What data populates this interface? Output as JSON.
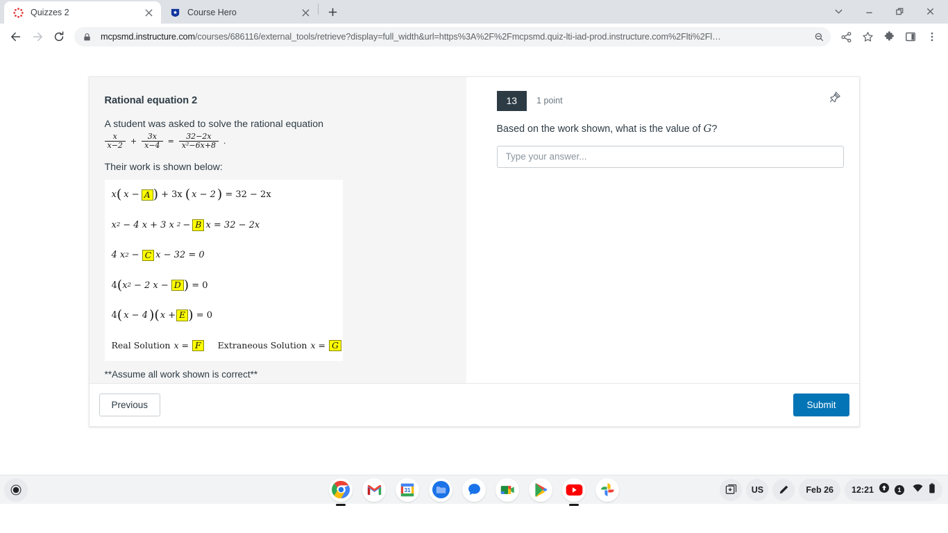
{
  "browser": {
    "tabs": [
      {
        "title": "Quizzes 2",
        "favicon": "canvas-spinner-icon",
        "active": true
      },
      {
        "title": "Course Hero",
        "favicon": "course-hero-shield-icon",
        "active": false
      }
    ],
    "new_tab_label": "+",
    "nav": {
      "back": "back-arrow-icon",
      "forward": "forward-arrow-icon",
      "reload": "reload-icon"
    },
    "omnibox": {
      "lock": "site-lock-icon",
      "url_domain": "mcpsmd.instructure.com",
      "url_path": "/courses/686116/external_tools/retrieve?display=full_width&url=https%3A%2F%2Fmcpsmd.quiz-lti-iad-prod.instructure.com%2Flti%2Fl…",
      "zoom_icon": "zoom-out-icon"
    },
    "actions": {
      "share": "share-icon",
      "bookmark": "bookmark-star-icon",
      "extensions": "extensions-puzzle-icon",
      "sidepanel": "side-panel-icon",
      "menu": "three-dot-menu-icon"
    },
    "window": {
      "tablist": "tab-search-chevron-icon",
      "minimize": "minimize-icon",
      "maximize": "maximize-icon",
      "close": "close-icon"
    }
  },
  "quiz": {
    "stimulus": {
      "title": "Rational equation 2",
      "intro": "A student was asked to solve the rational equation",
      "equation": {
        "term1": {
          "num": "x",
          "den": "x−2"
        },
        "op1": "+",
        "term2": {
          "num": "3x",
          "den": "x−4"
        },
        "op2": "=",
        "term3": {
          "num": "32−2x",
          "den": "x²−6x+8"
        },
        "period": "."
      },
      "work_label": "Their work is shown below:",
      "work_lines": [
        "x(x − [A]) + 3x(x − 2) = 32 − 2x",
        "x² − 4x + 3x² −[B]x = 32 − 2x",
        "4x² −[C]x − 32 = 0",
        "4(x² − 2x −[D]) = 0",
        "4(x − 4)(x +[E]) = 0",
        "Real Solution x = [F]    Extraneous  Solution x = [G]"
      ],
      "blanks": [
        "A",
        "B",
        "C",
        "D",
        "E",
        "F",
        "G"
      ],
      "line1": {
        "a": "x",
        "b": "x −",
        "blank": "A",
        "c": "+ 3x",
        "d": "x − 2",
        "e": "= 32 − 2x"
      },
      "line2": {
        "a": "x",
        "sup": "2",
        "b": "− 4 x  +  3 x",
        "sup2": "2",
        "c": "−",
        "blank": "B",
        "d": "x = 32 − 2x"
      },
      "line3": {
        "a": "4 x",
        "sup": "2",
        "b": "−",
        "blank": "C",
        "c": "x − 32 = 0"
      },
      "line4": {
        "a": "4",
        "b": "x",
        "sup": "2",
        "c": "− 2 x  −",
        "blank": "D",
        "d": "= 0"
      },
      "line5": {
        "a": "4",
        "b": "x −  4",
        "c": "x +",
        "blank": "E",
        "d": "= 0"
      },
      "line6": {
        "a": "Real Solution",
        "b": "x =",
        "blank1": "F",
        "c": "Extraneous   Solution",
        "d": "x =",
        "blank2": "G"
      },
      "assume_note": "**Assume all work shown is correct**"
    },
    "question": {
      "number": "13",
      "points": "1 point",
      "pin_icon": "pushpin-icon",
      "prompt_before": "Based on the work shown, what is the value of ",
      "prompt_var": "G",
      "prompt_after": "?",
      "answer_value": "",
      "answer_placeholder": "Type your answer..."
    },
    "footer": {
      "previous_label": "Previous",
      "submit_label": "Submit"
    },
    "colors": {
      "submit_blue": "#0374b5",
      "question_badge": "#2d3b45",
      "highlight_yellow": "#ffff00"
    }
  },
  "shelf": {
    "launcher": "launcher-icon",
    "apps": [
      {
        "name": "chrome-icon",
        "label": "Chrome",
        "running": true
      },
      {
        "name": "gmail-icon",
        "label": "Gmail",
        "running": false
      },
      {
        "name": "calendar-icon",
        "label": "Calendar",
        "running": false
      },
      {
        "name": "files-icon",
        "label": "Files",
        "running": false
      },
      {
        "name": "messages-icon",
        "label": "Messages",
        "running": false
      },
      {
        "name": "meet-icon",
        "label": "Google Meet",
        "running": false
      },
      {
        "name": "play-store-icon",
        "label": "Play Store",
        "running": false
      },
      {
        "name": "youtube-icon",
        "label": "YouTube",
        "running": true
      },
      {
        "name": "photos-icon",
        "label": "Photos",
        "running": false
      }
    ],
    "tray": {
      "screen_capture": "screen-capture-icon",
      "keyboard_layout": "US",
      "stylus": "stylus-pen-icon",
      "date": "Feb 26",
      "time": "12:21",
      "notification_count": "1",
      "wifi": "wifi-icon",
      "battery": "battery-icon"
    }
  }
}
